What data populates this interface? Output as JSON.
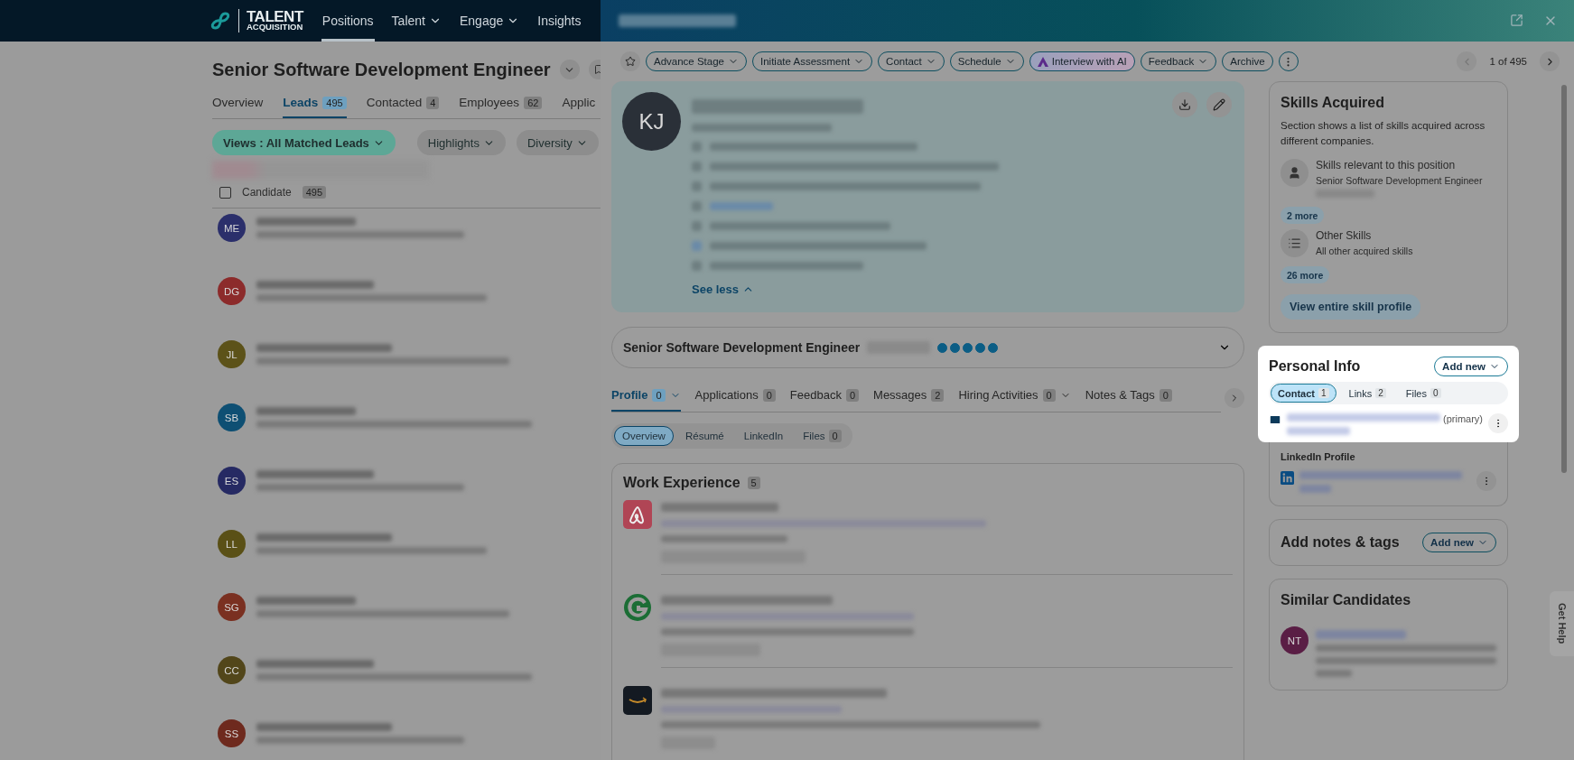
{
  "top_nav": {
    "brand_line_1": "TALENT",
    "brand_line_2": "ACQUISITION",
    "items": [
      {
        "label": "Positions",
        "selected": true,
        "dropdown": false
      },
      {
        "label": "Talent",
        "selected": false,
        "dropdown": true
      },
      {
        "label": "Engage",
        "selected": false,
        "dropdown": true
      },
      {
        "label": "Insights",
        "selected": false,
        "dropdown": false
      }
    ]
  },
  "position": {
    "title": "Senior Software Development Engineer",
    "tabs": [
      {
        "label": "Overview",
        "selected": false
      },
      {
        "label": "Leads",
        "count": "495",
        "selected": true
      },
      {
        "label": "Contacted",
        "count": "4",
        "selected": false
      },
      {
        "label": "Employees",
        "count": "62",
        "selected": false
      },
      {
        "label": "Applic",
        "selected": false
      }
    ],
    "filters": [
      {
        "label": "Views : All Matched Leads",
        "kind": "view"
      },
      {
        "label": "Highlights",
        "kind": "dropdown"
      },
      {
        "label": "Diversity",
        "kind": "dropdown"
      }
    ]
  },
  "candidate_list": {
    "header": "Candidate",
    "count": "495",
    "select_all_checked": false,
    "rows": [
      {
        "initials": "ME",
        "color": "#2b2f6b"
      },
      {
        "initials": "DG",
        "color": "#8c2b2b"
      },
      {
        "initials": "JL",
        "color": "#5c5219"
      },
      {
        "initials": "SB",
        "color": "#0e4f73"
      },
      {
        "initials": "ES",
        "color": "#262a63"
      },
      {
        "initials": "LL",
        "color": "#5a5016"
      },
      {
        "initials": "SG",
        "color": "#7a3021"
      },
      {
        "initials": "CC",
        "color": "#52461a"
      },
      {
        "initials": "SS",
        "color": "#6e2a1e"
      }
    ]
  },
  "drawer": {
    "actions": [
      {
        "label": "Advance Stage",
        "kind": "dropdown"
      },
      {
        "label": "Initiate Assessment",
        "kind": "dropdown"
      },
      {
        "label": "Contact",
        "kind": "dropdown"
      },
      {
        "label": "Schedule",
        "kind": "dropdown"
      },
      {
        "label": "Interview with AI",
        "kind": "ai"
      },
      {
        "label": "Feedback",
        "kind": "dropdown"
      },
      {
        "label": "Archive",
        "kind": "plain"
      }
    ],
    "pager": "1 of 495",
    "profile": {
      "initials": "KJ",
      "see_less": "See less"
    },
    "job_match": {
      "title": "Senior Software Development Engineer",
      "stars": 5
    },
    "tabs": [
      {
        "label": "Profile",
        "count": "0",
        "selected": true,
        "dropdown": true
      },
      {
        "label": "Applications",
        "count": "0",
        "selected": false,
        "dropdown": false
      },
      {
        "label": "Feedback",
        "count": "0",
        "selected": false,
        "dropdown": false
      },
      {
        "label": "Messages",
        "count": "2",
        "selected": false,
        "dropdown": false
      },
      {
        "label": "Hiring Activities",
        "count": "0",
        "selected": false,
        "dropdown": true
      },
      {
        "label": "Notes & Tags",
        "count": "0",
        "selected": false,
        "dropdown": false
      }
    ],
    "subtabs": [
      {
        "label": "Overview",
        "selected": true
      },
      {
        "label": "Résumé",
        "selected": false
      },
      {
        "label": "LinkedIn",
        "selected": false
      },
      {
        "label": "Files",
        "count": "0",
        "selected": false
      }
    ],
    "work_experience": {
      "title": "Work Experience",
      "count": "5",
      "entries": [
        {
          "kind": "loop"
        },
        {
          "kind": "letter"
        },
        {
          "kind": "smile"
        }
      ]
    }
  },
  "skills": {
    "title": "Skills Acquired",
    "description": "Section shows a list of skills acquired across different companies.",
    "groups": [
      {
        "kind": "relevant",
        "title": "Skills relevant to this position",
        "subtitle": "Senior Software Development Engineer",
        "more": "2 more"
      },
      {
        "kind": "other",
        "title": "Other Skills",
        "subtitle": "All other acquired skills",
        "more": "26 more"
      }
    ],
    "button": "View entire skill profile"
  },
  "personal_info": {
    "title": "Personal Info",
    "add_button": "Add new",
    "tabs": [
      {
        "label": "Contact",
        "count": "1",
        "selected": true
      },
      {
        "label": "Links",
        "count": "2",
        "selected": false
      },
      {
        "label": "Files",
        "count": "0",
        "selected": false
      }
    ],
    "email_tag": "(primary)",
    "linkedin_label": "LinkedIn Profile"
  },
  "notes": {
    "title": "Add notes & tags",
    "add_button": "Add new"
  },
  "similar": {
    "title": "Similar Candidates",
    "candidates": [
      {
        "initials": "NT",
        "color": "#5a1e45"
      }
    ]
  },
  "help_tab": "Get Help"
}
